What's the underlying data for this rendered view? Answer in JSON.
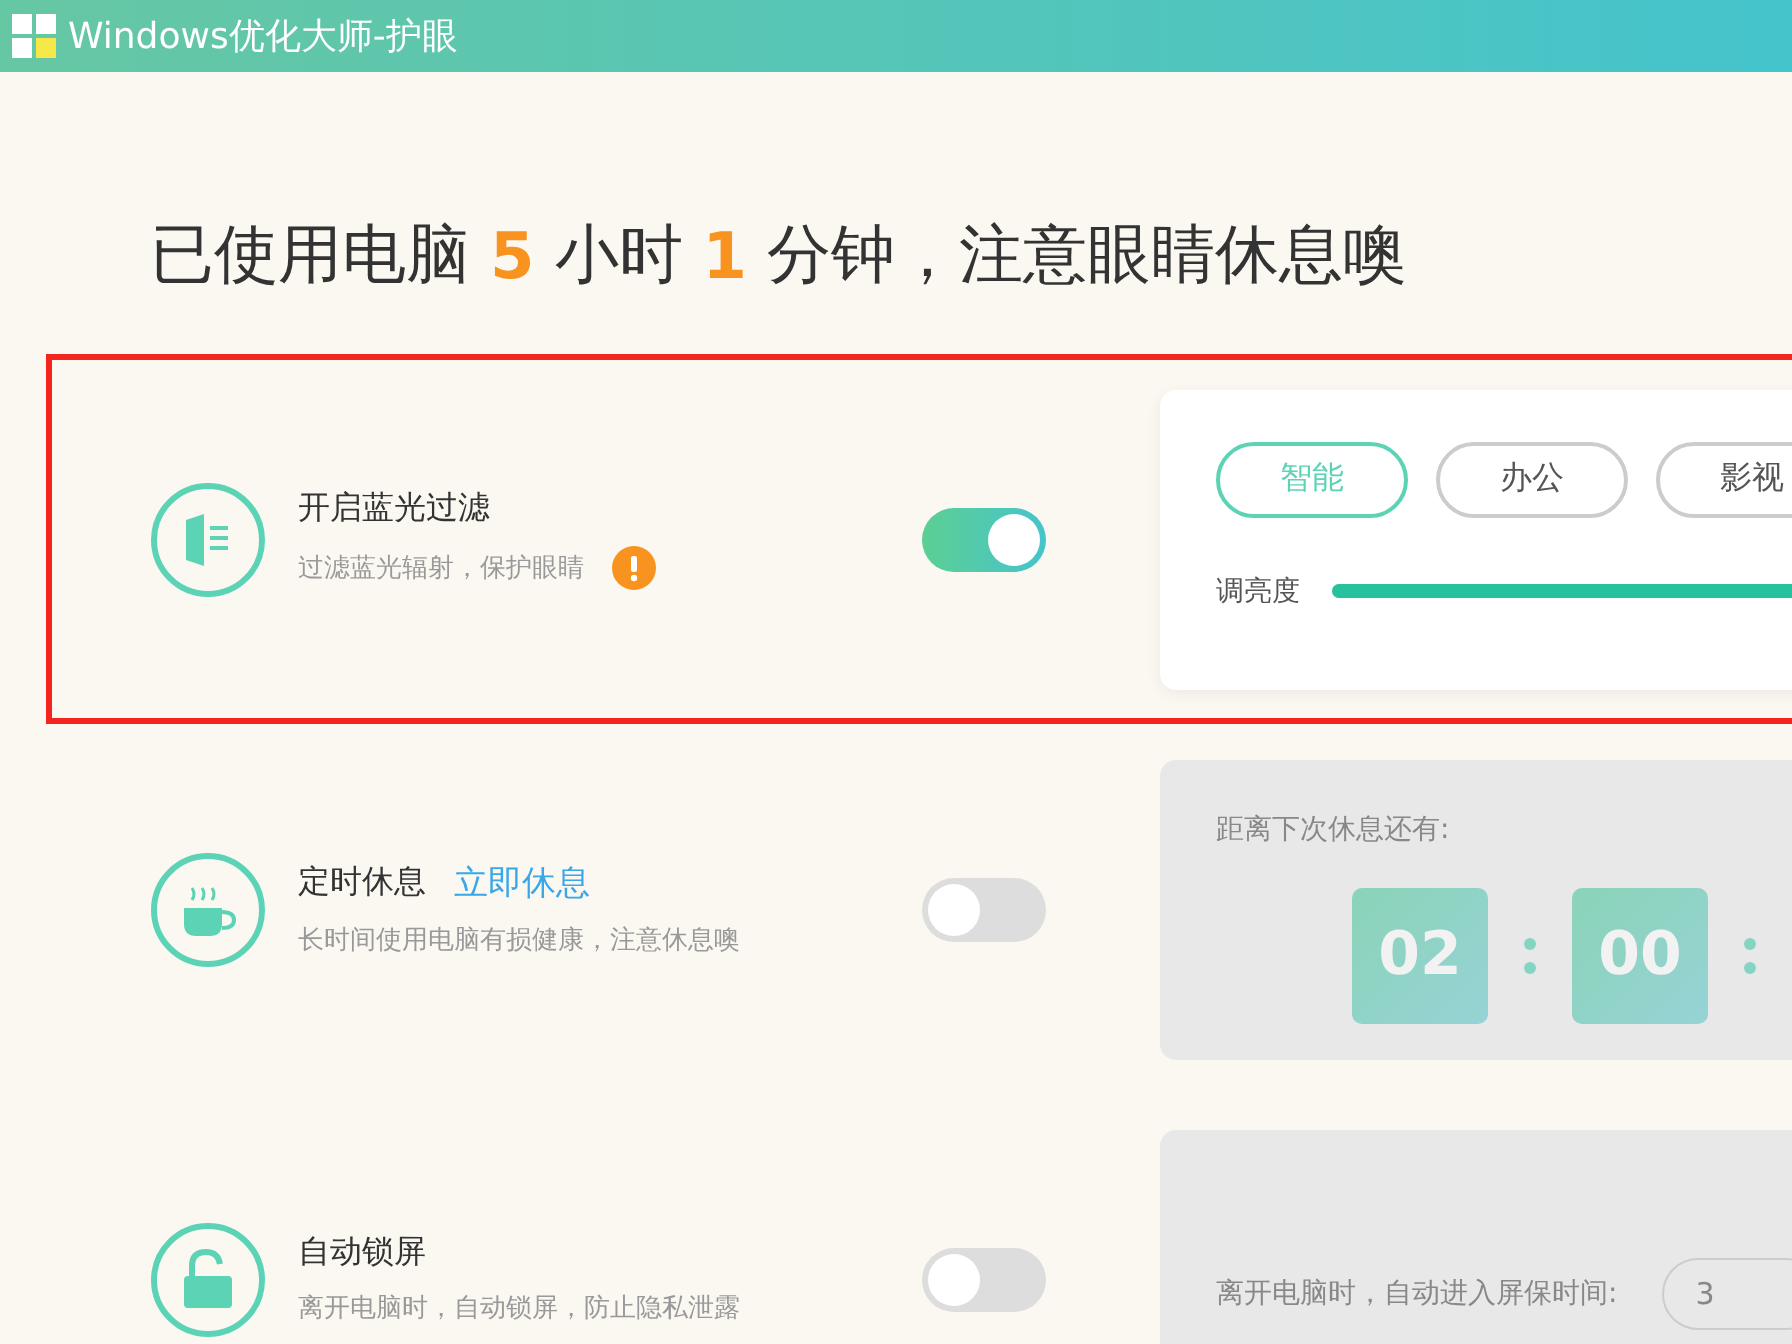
{
  "window": {
    "title": "Windows优化大师-护眼"
  },
  "headline": {
    "before": "已使用电脑",
    "hours": "5",
    "hours_unit": "小时",
    "minutes": "1",
    "after": "分钟，注意眼睛休息噢"
  },
  "features": [
    {
      "kind": "filter",
      "title": "开启蓝光过滤",
      "description": "过滤蓝光辐射，保护眼睛",
      "warning": true,
      "on": true,
      "highlighted": true,
      "panel": {
        "kind": "modes",
        "modes": [
          {
            "label": "智能",
            "selected": true
          },
          {
            "label": "办公",
            "selected": false
          },
          {
            "label": "影视",
            "selected": false
          }
        ],
        "slider_label": "调亮度",
        "level": 1
      }
    },
    {
      "kind": "rest",
      "title": "定时休息",
      "link": "立即休息",
      "description": "长时间使用电脑有损健康，注意休息噢",
      "warning": false,
      "on": false,
      "highlighted": false,
      "panel": {
        "kind": "countdown",
        "caption": "距离下次休息还有:",
        "hours": "02",
        "minutes": "00"
      }
    },
    {
      "kind": "lock",
      "title": "自动锁屏",
      "description": "离开电脑时，自动锁屏，防止隐私泄露",
      "warning": false,
      "on": false,
      "highlighted": false,
      "panel": {
        "kind": "screensaver",
        "caption": "离开电脑时，自动进入屏保时间:",
        "value": "3"
      }
    }
  ]
}
